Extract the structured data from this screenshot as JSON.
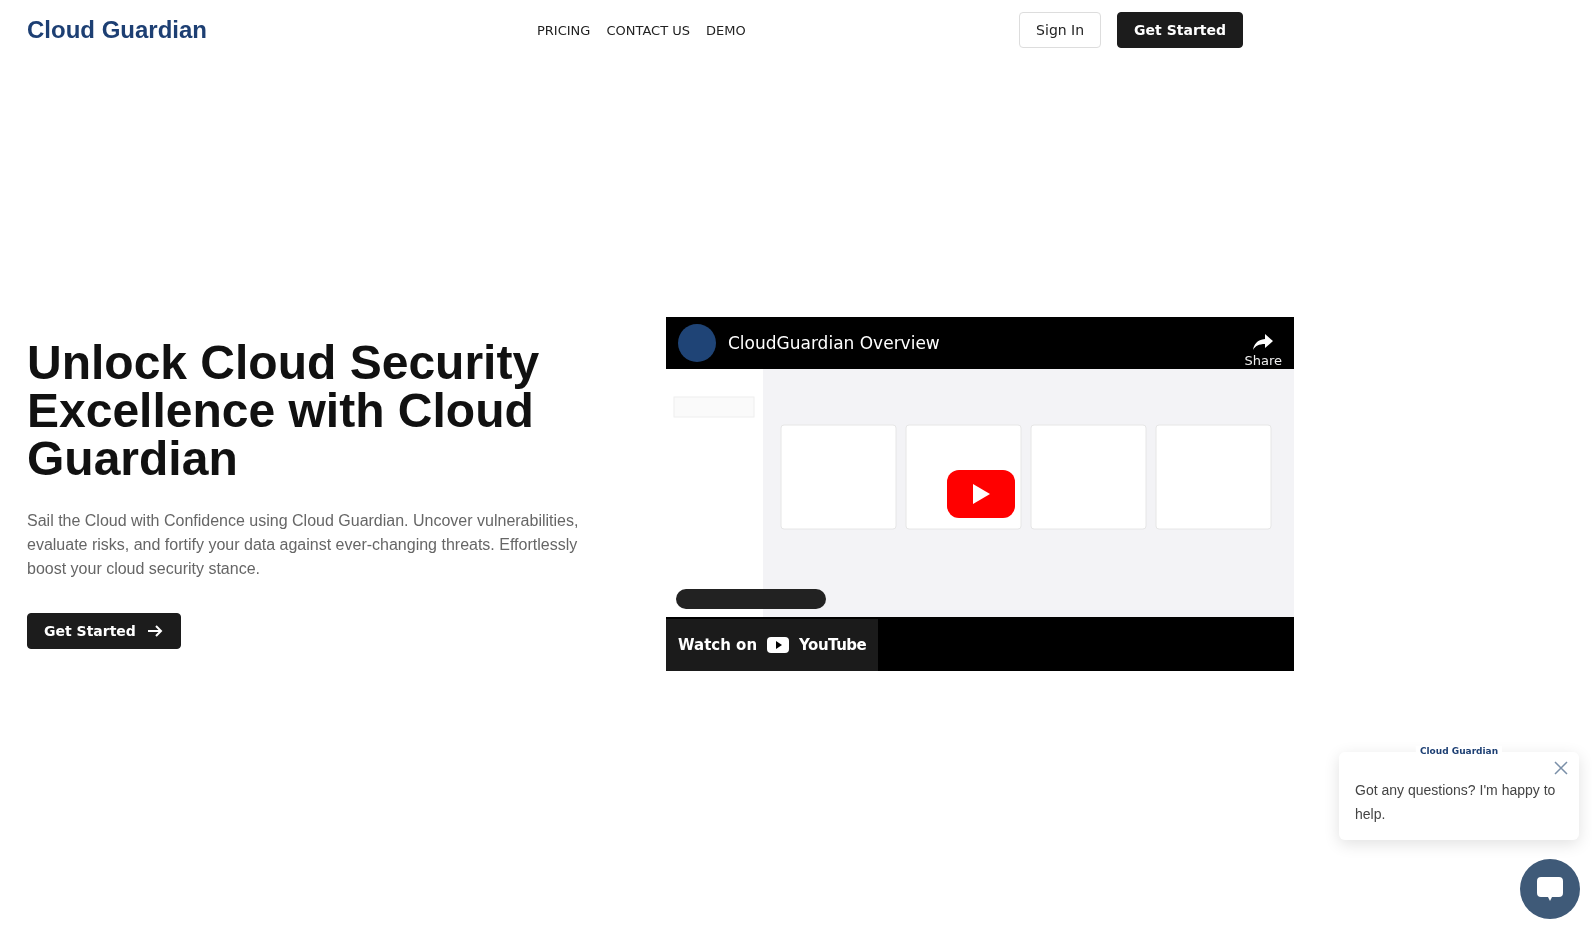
{
  "header": {
    "logo": "Cloud Guardian",
    "nav": [
      {
        "label": "PRICING"
      },
      {
        "label": "CONTACT US"
      },
      {
        "label": "DEMO"
      }
    ],
    "sign_in": "Sign In",
    "get_started": "Get Started"
  },
  "hero": {
    "title": "Unlock Cloud Security Excellence with Cloud Guardian",
    "text": "Sail the Cloud with Confidence using Cloud Guardian. Uncover vulnerabilities, evaluate risks, and fortify your data against ever-changing threats. Effortlessly boost your cloud security stance.",
    "button": "Get Started"
  },
  "video": {
    "kind": "picture",
    "title": "CloudGuardian Overview",
    "share": "Share",
    "watch_on": "Watch on",
    "brand": "YouTube"
  },
  "chat": {
    "brand": "Cloud Guardian",
    "message": "Got any questions? I'm happy to help."
  }
}
